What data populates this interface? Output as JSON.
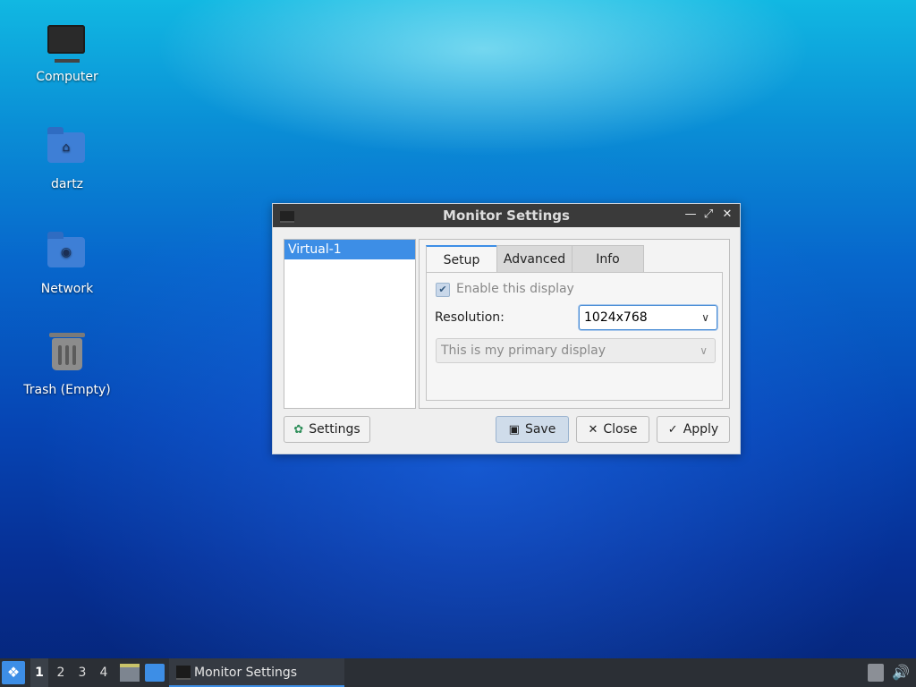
{
  "desktop": {
    "icons": [
      {
        "label": "Computer",
        "icon": "computer-icon"
      },
      {
        "label": "dartz",
        "icon": "home-folder-icon"
      },
      {
        "label": "Network",
        "icon": "network-folder-icon"
      },
      {
        "label": "Trash (Empty)",
        "icon": "trash-icon"
      }
    ]
  },
  "window": {
    "title": "Monitor Settings",
    "controls": [
      "minimize",
      "maximize",
      "close"
    ],
    "outputs": [
      "Virtual-1"
    ],
    "selected_output": "Virtual-1",
    "tabs": [
      {
        "label": "Setup",
        "active": true
      },
      {
        "label": "Advanced",
        "active": false
      },
      {
        "label": "Info",
        "active": false
      }
    ],
    "setup": {
      "enable_label": "Enable this display",
      "enable_checked": true,
      "resolution_label": "Resolution:",
      "resolution_value": "1024x768",
      "primary_value": "This is my primary display"
    },
    "buttons": {
      "settings": "Settings",
      "save": "Save",
      "close": "Close",
      "apply": "Apply"
    }
  },
  "taskbar": {
    "workspaces": [
      "1",
      "2",
      "3",
      "4"
    ],
    "active_workspace": "1",
    "task_label": "Monitor Settings"
  },
  "colors": {
    "accent": "#3d8ee6",
    "titlebar": "#3a3a3a",
    "taskbar": "#2b2f35"
  }
}
